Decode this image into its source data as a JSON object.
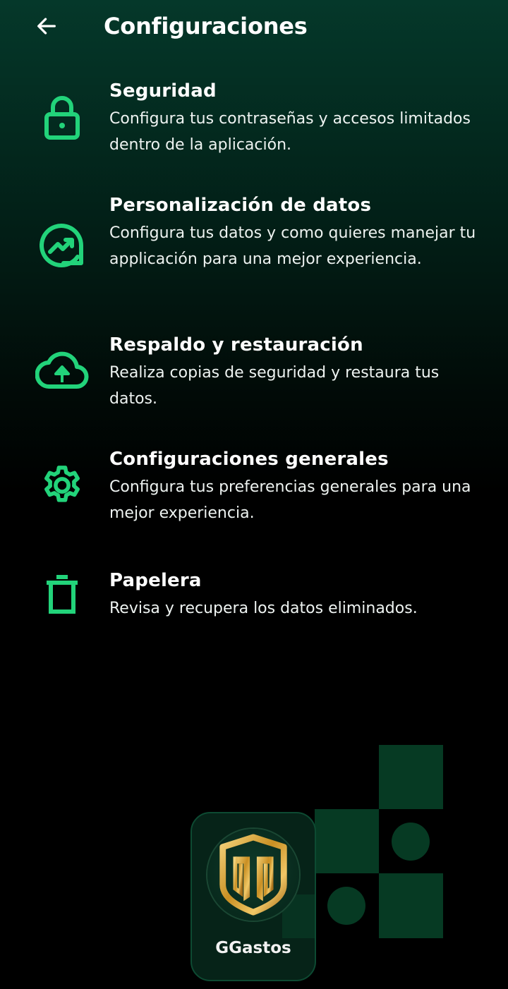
{
  "header": {
    "back_icon": "arrow-left-icon",
    "title": "Configuraciones"
  },
  "menu": [
    {
      "icon": "lock-icon",
      "title": "Seguridad",
      "description": "Configura tus contraseñas y accesos limitados dentro de la aplicación."
    },
    {
      "icon": "trending-up-chart-icon",
      "title": "Personalización de datos",
      "description": "Configura tus datos y como quieres manejar tu applicación para una mejor experiencia."
    },
    {
      "icon": "cloud-upload-icon",
      "title": "Respaldo y restauración",
      "description": "Realiza copias de seguridad y restaura tus datos."
    },
    {
      "icon": "gear-icon",
      "title": "Configuraciones generales",
      "description": "Configura tus preferencias generales para una mejor experiencia."
    },
    {
      "icon": "trash-icon",
      "title": "Papelera",
      "description": "Revisa y recupera los datos eliminados."
    }
  ],
  "app_card": {
    "logo_icon": "ggastos-logo",
    "name": "GGastos"
  },
  "colors": {
    "accent": "#22d37a",
    "background_top": "#05382a",
    "background_bottom": "#000000",
    "deco_green": "#063a23",
    "logo_gold": "#d4a636"
  }
}
